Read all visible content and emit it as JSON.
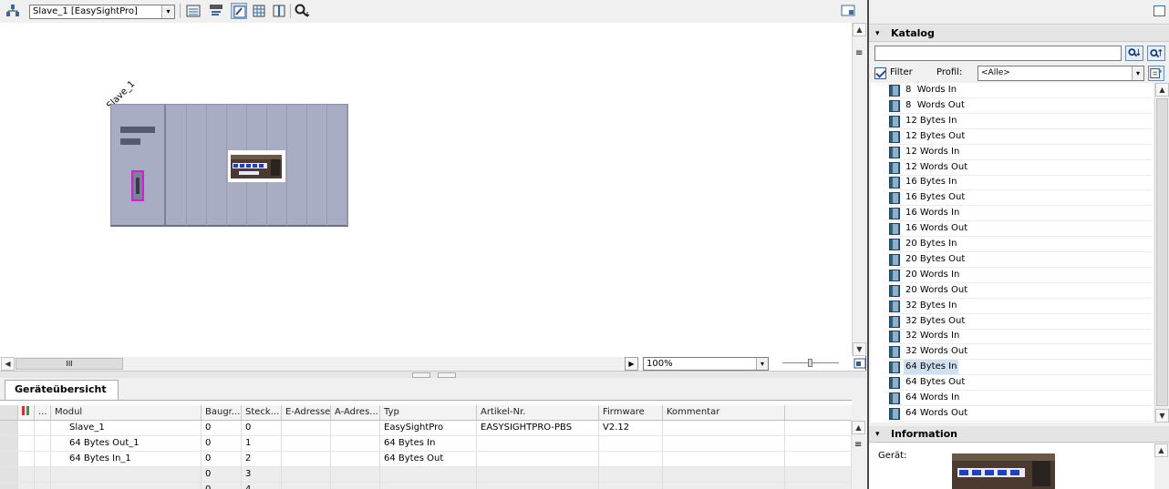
{
  "editor": {
    "device_select": "Slave_1 [EasySightPro]",
    "slave_label": "Slave_1",
    "zoom": "100%",
    "vscroll_menu_glyph": "≡",
    "hscroll_glyph": "III"
  },
  "overview": {
    "tab_label": "Geräteübersicht",
    "columns": [
      "...",
      "Modul",
      "Baugr...",
      "Steck...",
      "E-Adresse",
      "A-Adres...",
      "Typ",
      "Artikel-Nr.",
      "Firmware",
      "Kommentar"
    ],
    "rows": [
      {
        "modul": "Slave_1",
        "baugr": "0",
        "steck": "0",
        "e_adresse": "",
        "a_adresse": "",
        "typ": "EasySightPro",
        "artikel": "EASYSIGHTPRO-PBS",
        "firmware": "V2.12",
        "kommentar": ""
      },
      {
        "modul": "64 Bytes Out_1",
        "baugr": "0",
        "steck": "1",
        "e_adresse": "",
        "a_adresse": "",
        "typ": "64 Bytes In",
        "artikel": "",
        "firmware": "",
        "kommentar": ""
      },
      {
        "modul": "64 Bytes In_1",
        "baugr": "0",
        "steck": "2",
        "e_adresse": "",
        "a_adresse": "",
        "typ": "64 Bytes Out",
        "artikel": "",
        "firmware": "",
        "kommentar": ""
      },
      {
        "modul": "",
        "baugr": "0",
        "steck": "3",
        "e_adresse": "",
        "a_adresse": "",
        "typ": "",
        "artikel": "",
        "firmware": "",
        "kommentar": ""
      },
      {
        "modul": "",
        "baugr": "0",
        "steck": "4",
        "e_adresse": "",
        "a_adresse": "",
        "typ": "",
        "artikel": "",
        "firmware": "",
        "kommentar": ""
      }
    ]
  },
  "catalog": {
    "title": "Katalog",
    "search_value": "",
    "filter_label": "Filter",
    "filter_checked": true,
    "profil_label": "Profil:",
    "profil_value": "<Alle>",
    "items": [
      "8  Words In",
      "8  Words Out",
      "12 Bytes In",
      "12 Bytes Out",
      "12 Words In",
      "12 Words Out",
      "16 Bytes In",
      "16 Bytes Out",
      "16 Words In",
      "16 Words Out",
      "20 Bytes In",
      "20 Bytes Out",
      "20 Words In",
      "20 Words Out",
      "32 Bytes In",
      "32 Bytes Out",
      "32 Words In",
      "32 Words Out",
      "64 Bytes In",
      "64 Bytes Out",
      "64 Words In",
      "64 Words Out"
    ],
    "selected_item": "64 Bytes In"
  },
  "information": {
    "title": "Information",
    "geraet_label": "Gerät:"
  },
  "icons": {
    "chevron": "▾",
    "scroll_up": "▲",
    "scroll_down": "▼",
    "scroll_left": "◀",
    "scroll_right": "▶"
  },
  "colors": {
    "device_body": "#a9adc3",
    "selection": "#cfe0f2",
    "port_highlight": "#d020d0"
  }
}
